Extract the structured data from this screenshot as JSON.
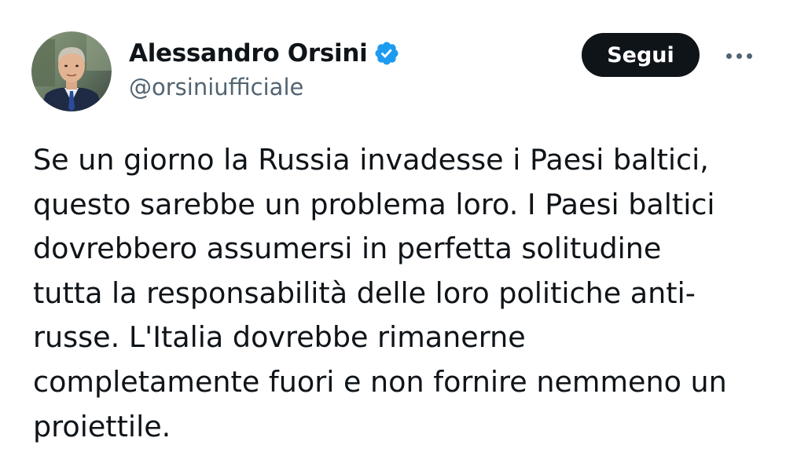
{
  "author": {
    "display_name": "Alessandro Orsini",
    "handle": "@orsiniufficiale",
    "verified": true,
    "verified_icon": "verified-badge-icon",
    "verified_color": "#1d9bf0"
  },
  "actions": {
    "follow_label": "Segui",
    "more_icon": "more-horizontal-icon"
  },
  "tweet": {
    "lines": [
      "Se un giorno la Russia invadesse i Paesi baltici,",
      "questo sarebbe un problema loro. I Paesi baltici",
      "dovrebbero assumersi in perfetta solitudine",
      "tutta la responsabilità delle loro politiche anti-",
      "russe. L'Italia dovrebbe rimanerne",
      "completamente fuori e non fornire nemmeno un",
      "proiettile."
    ]
  },
  "colors": {
    "text_primary": "#0f1419",
    "text_secondary": "#536471",
    "button_bg": "#0f1419",
    "button_text": "#ffffff"
  }
}
